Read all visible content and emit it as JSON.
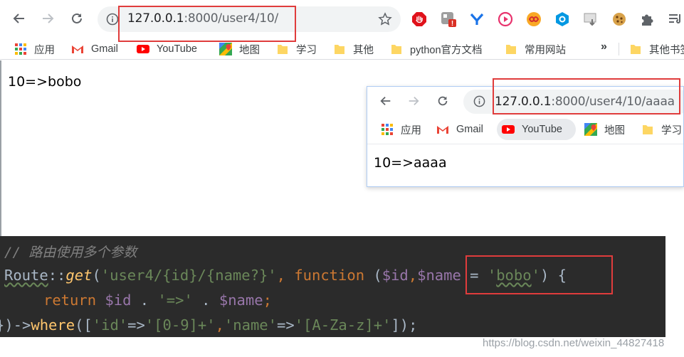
{
  "main_browser": {
    "url": {
      "host": "127.0.0.1",
      "rest": ":8000/user4/10/"
    },
    "bookmarks": [
      {
        "label": "应用",
        "icon": "apps-grid-icon"
      },
      {
        "label": "Gmail",
        "icon": "gmail-icon"
      },
      {
        "label": "YouTube",
        "icon": "youtube-icon"
      },
      {
        "label": "地图",
        "icon": "maps-icon"
      },
      {
        "label": "学习",
        "icon": "folder-icon"
      },
      {
        "label": "其他",
        "icon": "folder-icon"
      },
      {
        "label": "python官方文档",
        "icon": "folder-icon"
      },
      {
        "label": "常用网站",
        "icon": "folder-icon"
      },
      {
        "label": "其他书签",
        "icon": "folder-icon"
      }
    ],
    "more_label": "»",
    "page_text": "10=>bobo",
    "extensions": [
      "adblock-icon",
      "extension-badge-icon",
      "yoyo-icon",
      "record-icon",
      "infinity-icon",
      "hexagon-icon",
      "download-icon",
      "cookie-icon",
      "puzzle-icon",
      "reading-list-icon"
    ]
  },
  "second_browser": {
    "url": {
      "host": "127.0.0.1",
      "rest": ":8000/user4/10/aaaa"
    },
    "bookmarks": [
      {
        "label": "应用",
        "icon": "apps-grid-icon"
      },
      {
        "label": "Gmail",
        "icon": "gmail-icon"
      },
      {
        "label": "YouTube",
        "icon": "youtube-icon"
      },
      {
        "label": "地图",
        "icon": "maps-icon"
      },
      {
        "label": "学习",
        "icon": "folder-icon"
      }
    ],
    "page_text": "10=>aaaa"
  },
  "code": {
    "comment": "// 路由使用多个参数",
    "line1": {
      "class": "Route",
      "sep": "::",
      "method": "get",
      "paren_open": "(",
      "route_str": "'user4/{id}/{name?}'",
      "comma": ", ",
      "kw_function": "function",
      "params_open": " (",
      "var_id": "$id",
      "param_comma": ",",
      "var_name": "$name",
      "eq": " = ",
      "q1": "'",
      "default_str": "bobo",
      "q2": "'",
      "close": ") {"
    },
    "line2": {
      "kw_return": "return",
      "var_id": "$id",
      "concat1": " . ",
      "arrow_str": "'=>'",
      "concat2": " . ",
      "var_name": "$name",
      "semi": ";"
    },
    "line3": {
      "open": "})->",
      "method": "where",
      "args_open": "([",
      "key1": "'id'",
      "arrow1": "=>",
      "val1": "'[0-9]+'",
      "sep": ",",
      "key2": "'name'",
      "arrow2": "=>",
      "val2": "'[A-Za-z]+'",
      "args_close": "]);"
    }
  },
  "watermark": "https://blog.csdn.net/weixin_44827418",
  "colors": {
    "highlight": "#e03c3c",
    "editor_bg": "#2b2b2b"
  }
}
